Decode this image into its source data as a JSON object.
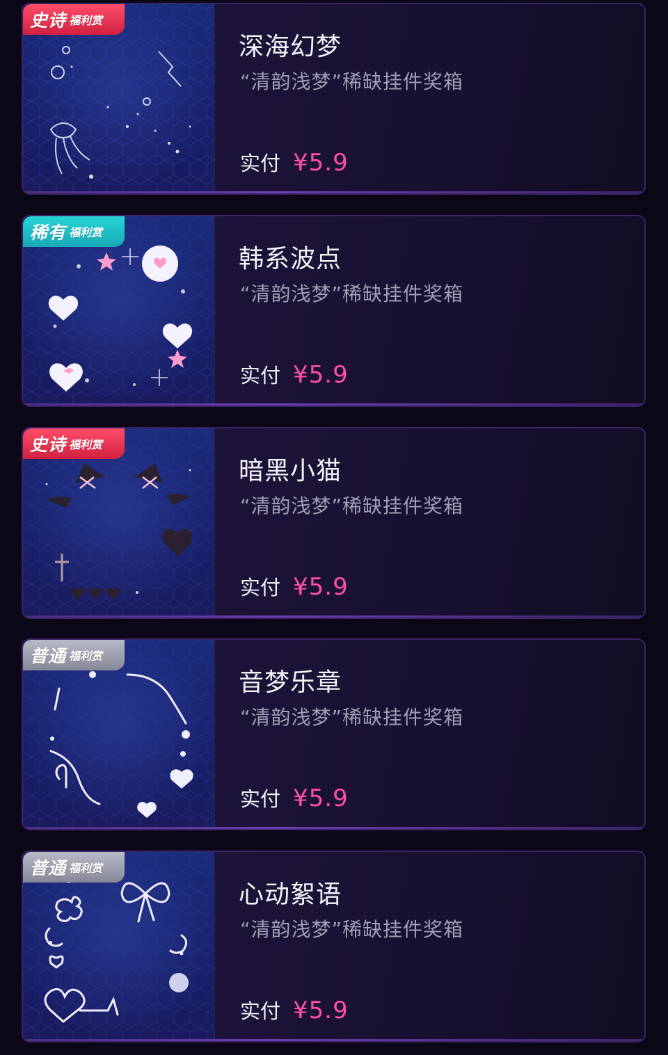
{
  "cards": [
    {
      "rarity": "epic",
      "tier_label": "史诗",
      "badge_sub": "福利赏",
      "title": "深海幻梦",
      "desc": "“清韵浅梦”稀缺挂件奖箱",
      "price_label": "实付",
      "price": "¥5.9",
      "theme": "jellyfish"
    },
    {
      "rarity": "rare",
      "tier_label": "稀有",
      "badge_sub": "福利赏",
      "title": "韩系波点",
      "desc": "“清韵浅梦”稀缺挂件奖箱",
      "price_label": "实付",
      "price": "¥5.9",
      "theme": "hearts"
    },
    {
      "rarity": "epic",
      "tier_label": "史诗",
      "badge_sub": "福利赏",
      "title": "暗黑小猫",
      "desc": "“清韵浅梦”稀缺挂件奖箱",
      "price_label": "实付",
      "price": "¥5.9",
      "theme": "dark-cat"
    },
    {
      "rarity": "normal",
      "tier_label": "普通",
      "badge_sub": "福利赏",
      "title": "音梦乐章",
      "desc": "“清韵浅梦”稀缺挂件奖箱",
      "price_label": "实付",
      "price": "¥5.9",
      "theme": "music"
    },
    {
      "rarity": "normal",
      "tier_label": "普通",
      "badge_sub": "福利赏",
      "title": "心动絮语",
      "desc": "“清韵浅梦”稀缺挂件奖箱",
      "price_label": "实付",
      "price": "¥5.9",
      "theme": "bows"
    }
  ],
  "colors": {
    "price": "#ff4fa8",
    "epic": "#e02e4d",
    "rare": "#1fbfc8",
    "normal": "#9ea0ae",
    "background": "#0b0716"
  }
}
